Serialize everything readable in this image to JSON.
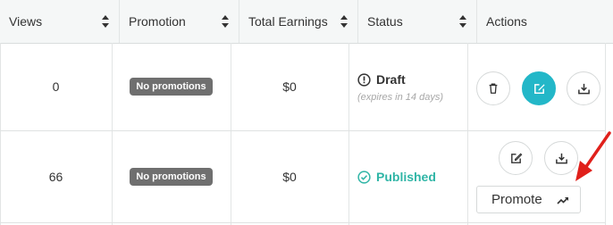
{
  "columns": [
    {
      "label": "Views",
      "sortable": true
    },
    {
      "label": "Promotion",
      "sortable": true
    },
    {
      "label": "Total Earnings",
      "sortable": true
    },
    {
      "label": "Status",
      "sortable": true
    },
    {
      "label": "Actions",
      "sortable": false
    }
  ],
  "rows": [
    {
      "views": "0",
      "promotion": "No promotions",
      "earnings": "$0",
      "status": "Draft",
      "status_note": "(expires in 14 days)",
      "status_icon": "exclamation-circle-icon",
      "actions": [
        "trash-icon",
        "edit-icon",
        "download-icon"
      ]
    },
    {
      "views": "66",
      "promotion": "No promotions",
      "earnings": "$0",
      "status": "Published",
      "status_icon": "check-circle-icon",
      "actions": [
        "edit-icon",
        "download-icon"
      ],
      "promote_label": "Promote",
      "promote_icon": "trending-up-icon"
    }
  ],
  "colors": {
    "header_bg": "#f5f7f7",
    "accent": "#23b7c8",
    "published": "#2fb5a6",
    "badge_bg": "#6f6f6f",
    "annotation_arrow": "#e0201b"
  }
}
